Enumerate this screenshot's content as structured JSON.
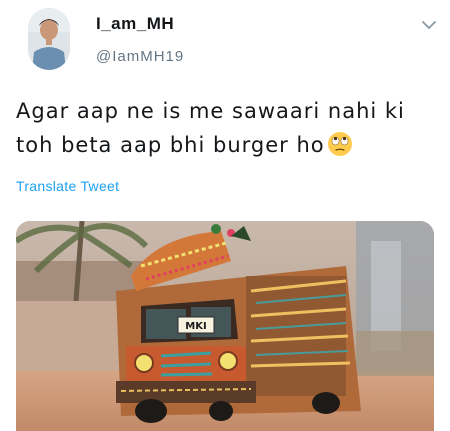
{
  "tweet": {
    "display_name": "I_am_MH",
    "handle": "@IamMH19",
    "text": "Agar aap ne is me sawaari nahi ki toh beta aap bhi burger ho",
    "translate_label": "Translate Tweet"
  },
  "icons": {
    "menu": "chevron-down-icon",
    "emoji": "face-with-rolling-eyes-icon"
  },
  "media": {
    "bus_plate_text": "MKI"
  },
  "colors": {
    "text": "#14171a",
    "secondary": "#657786",
    "link": "#1da1f2"
  }
}
